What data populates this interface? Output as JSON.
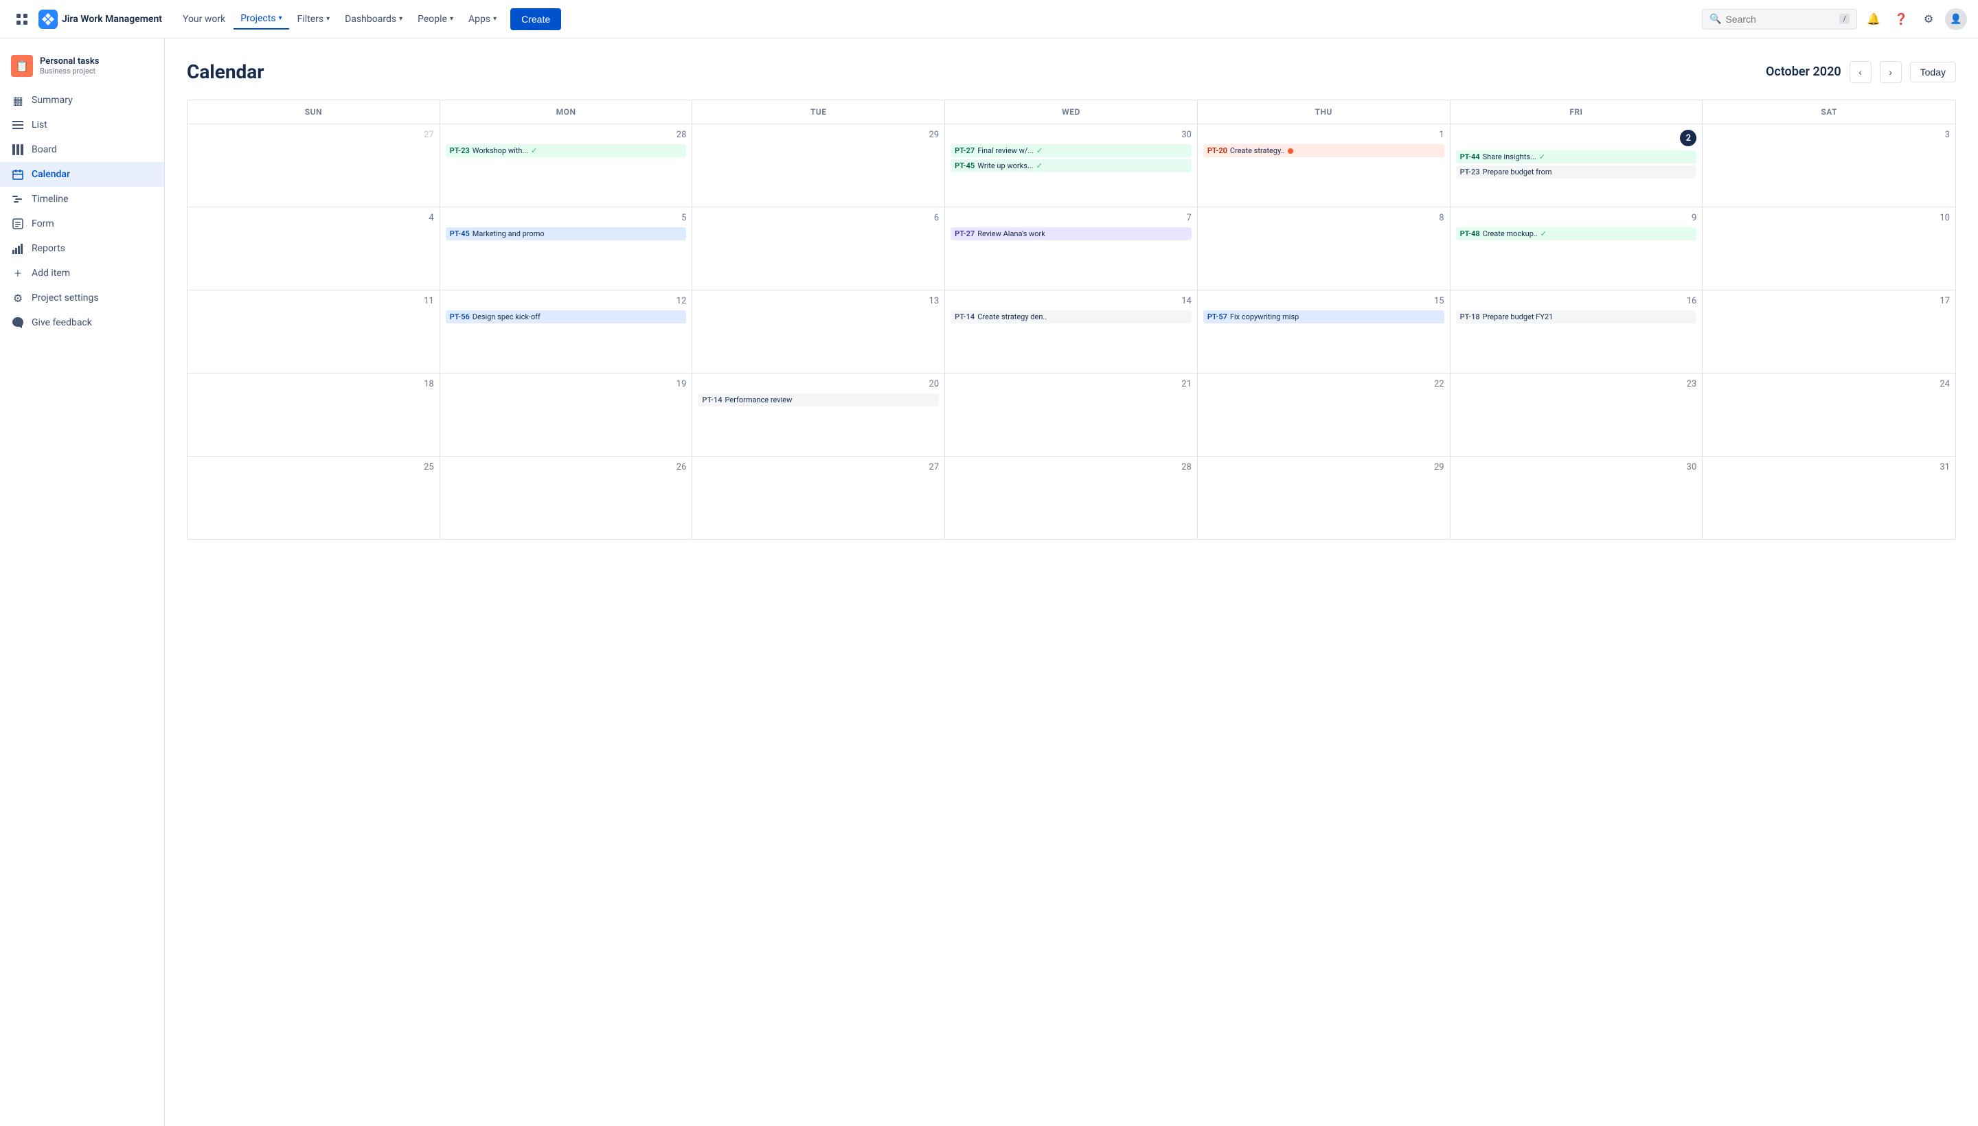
{
  "topnav": {
    "logo_text": "Jira Work Management",
    "your_work": "Your work",
    "projects": "Projects",
    "filters": "Filters",
    "dashboards": "Dashboards",
    "people": "People",
    "apps": "Apps",
    "create": "Create",
    "search_placeholder": "Search"
  },
  "sidebar": {
    "project_name": "Personal tasks",
    "project_type": "Business project",
    "items": [
      {
        "id": "summary",
        "label": "Summary",
        "icon": "▦"
      },
      {
        "id": "list",
        "label": "List",
        "icon": "≡"
      },
      {
        "id": "board",
        "label": "Board",
        "icon": "⊞"
      },
      {
        "id": "calendar",
        "label": "Calendar",
        "icon": "📅",
        "active": true
      },
      {
        "id": "timeline",
        "label": "Timeline",
        "icon": "⊶"
      },
      {
        "id": "form",
        "label": "Form",
        "icon": "⊡"
      },
      {
        "id": "reports",
        "label": "Reports",
        "icon": "📊"
      },
      {
        "id": "add-item",
        "label": "Add item",
        "icon": "+"
      },
      {
        "id": "project-settings",
        "label": "Project settings",
        "icon": "⚙"
      },
      {
        "id": "give-feedback",
        "label": "Give feedback",
        "icon": "📢"
      }
    ]
  },
  "calendar": {
    "title": "Calendar",
    "month_year": "October 2020",
    "today_btn": "Today",
    "days": [
      "SUN",
      "MON",
      "TUE",
      "WED",
      "THU",
      "FRI",
      "SAT"
    ],
    "weeks": [
      {
        "cells": [
          {
            "date": 27,
            "other_month": true,
            "tasks": []
          },
          {
            "date": 28,
            "tasks": [
              {
                "id": "PT-23",
                "label": "Workshop with...",
                "color": "green",
                "check": true
              }
            ]
          },
          {
            "date": 29,
            "tasks": []
          },
          {
            "date": 30,
            "tasks": [
              {
                "id": "PT-27",
                "label": "Final review w/...",
                "color": "green",
                "check": true
              },
              {
                "id": "PT-45",
                "label": "Write up works...",
                "color": "green",
                "check": true
              }
            ]
          },
          {
            "date": 1,
            "tasks": [
              {
                "id": "PT-20",
                "label": "Create strategy..",
                "color": "red",
                "dot": true
              }
            ]
          },
          {
            "date": 2,
            "today": true,
            "tasks": [
              {
                "id": "PT-44",
                "label": "Share insights...",
                "color": "green",
                "check": true
              },
              {
                "id": "PT-23",
                "label": "Prepare budget from",
                "color": "gray"
              }
            ]
          },
          {
            "date": 3,
            "other_month": false,
            "tasks": []
          }
        ]
      },
      {
        "cells": [
          {
            "date": 4,
            "tasks": []
          },
          {
            "date": 5,
            "tasks": [
              {
                "id": "PT-45",
                "label": "Marketing and promo",
                "color": "blue"
              }
            ]
          },
          {
            "date": 6,
            "tasks": []
          },
          {
            "date": 7,
            "tasks": [
              {
                "id": "PT-27",
                "label": "Review Alana's work",
                "color": "purple"
              }
            ]
          },
          {
            "date": 8,
            "tasks": []
          },
          {
            "date": 9,
            "tasks": [
              {
                "id": "PT-48",
                "label": "Create mockup..",
                "color": "green",
                "check": true
              }
            ]
          },
          {
            "date": 10,
            "tasks": []
          }
        ]
      },
      {
        "cells": [
          {
            "date": 11,
            "tasks": []
          },
          {
            "date": 12,
            "tasks": [
              {
                "id": "PT-56",
                "label": "Design spec kick-off",
                "color": "blue"
              }
            ]
          },
          {
            "date": 13,
            "tasks": []
          },
          {
            "date": 14,
            "tasks": [
              {
                "id": "PT-14",
                "label": "Create strategy den..",
                "color": "gray"
              }
            ]
          },
          {
            "date": 15,
            "tasks": [
              {
                "id": "PT-57",
                "label": "Fix copywriting misp",
                "color": "blue"
              }
            ]
          },
          {
            "date": 16,
            "tasks": [
              {
                "id": "PT-18",
                "label": "Prepare budget FY21",
                "color": "gray"
              }
            ]
          },
          {
            "date": 17,
            "tasks": []
          }
        ]
      },
      {
        "cells": [
          {
            "date": 18,
            "tasks": []
          },
          {
            "date": 19,
            "tasks": []
          },
          {
            "date": 20,
            "tasks": [
              {
                "id": "PT-14",
                "label": "Performance review",
                "color": "gray"
              }
            ]
          },
          {
            "date": 21,
            "tasks": []
          },
          {
            "date": 22,
            "tasks": []
          },
          {
            "date": 23,
            "tasks": []
          },
          {
            "date": 24,
            "tasks": []
          }
        ]
      },
      {
        "cells": [
          {
            "date": 25,
            "tasks": []
          },
          {
            "date": 26,
            "tasks": []
          },
          {
            "date": 27,
            "tasks": []
          },
          {
            "date": 28,
            "tasks": []
          },
          {
            "date": 29,
            "tasks": []
          },
          {
            "date": 30,
            "tasks": []
          },
          {
            "date": 31,
            "tasks": []
          }
        ]
      }
    ]
  }
}
